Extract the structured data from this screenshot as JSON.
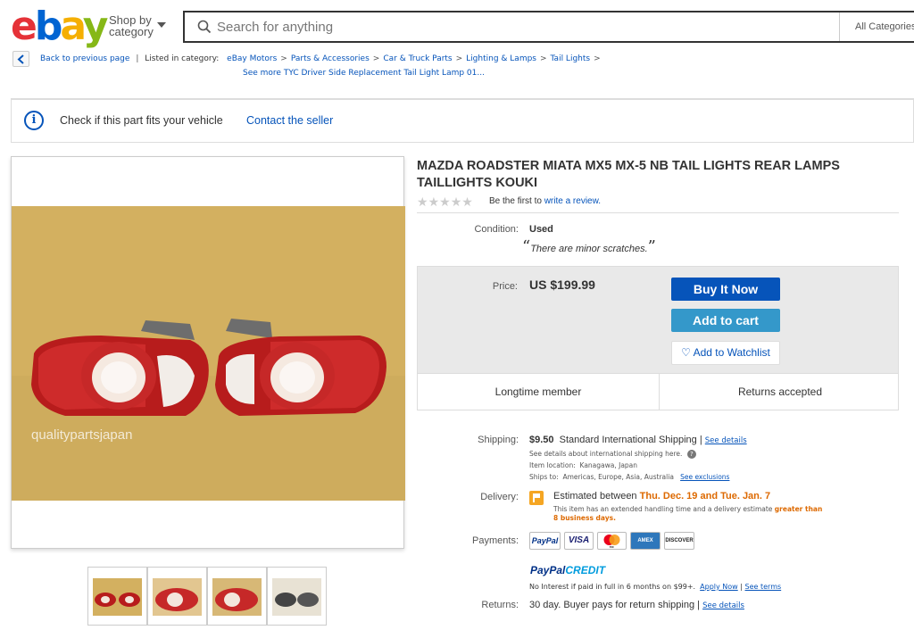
{
  "header": {
    "logo": {
      "e": "e",
      "b": "b",
      "a": "a",
      "y": "y"
    },
    "shop_by_line1": "Shop by",
    "shop_by_line2": "category",
    "search_placeholder": "Search for anything",
    "category_select": "All Categories"
  },
  "breadcrumb": {
    "back": "Back to previous page",
    "listed_in": "Listed in category:",
    "items": [
      "eBay Motors",
      "Parts & Accessories",
      "Car & Truck Parts",
      "Lighting & Lamps",
      "Tail Lights"
    ],
    "see_more": "See more TYC Driver Side Replacement Tail Light Lamp 01..."
  },
  "fitment": {
    "check_text": "Check if this part fits your vehicle",
    "contact": "Contact the seller"
  },
  "gallery": {
    "watermark": "qualitypartsjapan",
    "thumb_count": 4
  },
  "item": {
    "title": "MAZDA ROADSTER MIATA MX5 MX-5 NB TAIL LIGHTS REAR LAMPS TAILLIGHTS KOUKI",
    "rating_stars": 0,
    "review_prefix": "Be the first to",
    "review_link": "write a review.",
    "condition_label": "Condition:",
    "condition_value": "Used",
    "condition_note": "There are minor scratches.",
    "price_label": "Price:",
    "price": "US $199.99",
    "buy_now": "Buy It Now",
    "add_to_cart": "Add to cart",
    "watchlist": "Add to Watchlist",
    "badge_left": "Longtime member",
    "badge_right": "Returns accepted"
  },
  "shipping": {
    "label": "Shipping:",
    "cost": "$9.50",
    "method": "Standard International Shipping",
    "see_details": "See details",
    "intl_note": "See details about international shipping here.",
    "location_label": "Item location:",
    "location": "Kanagawa, Japan",
    "ships_label": "Ships to:",
    "ships_to": "Americas, Europe, Asia, Australia",
    "exclusions": "See exclusions"
  },
  "delivery": {
    "label": "Delivery:",
    "prefix": "Estimated between",
    "date_range": "Thu. Dec. 19 and Tue. Jan. 7",
    "note": "This item has an extended handling time and a delivery estimate",
    "note_orange": "greater than",
    "note_orange2": "8 business days."
  },
  "payments": {
    "label": "Payments:",
    "badges": [
      "PayPal",
      "VISA",
      "MC",
      "AMEX",
      "DISCOVER"
    ],
    "paypal_credit_a": "PayPal",
    "paypal_credit_b": "CREDIT",
    "credit_note": "No Interest if paid in full in 6 months on $99+.",
    "apply_now": "Apply Now",
    "see_terms": "See terms"
  },
  "returns": {
    "label": "Returns:",
    "text": "30 day. Buyer pays for return shipping",
    "see_details": "See details"
  },
  "colors": {
    "link": "#0654ba",
    "buy_button": "#0654ba",
    "cart_button": "#3498ca",
    "orange": "#dd6900"
  }
}
